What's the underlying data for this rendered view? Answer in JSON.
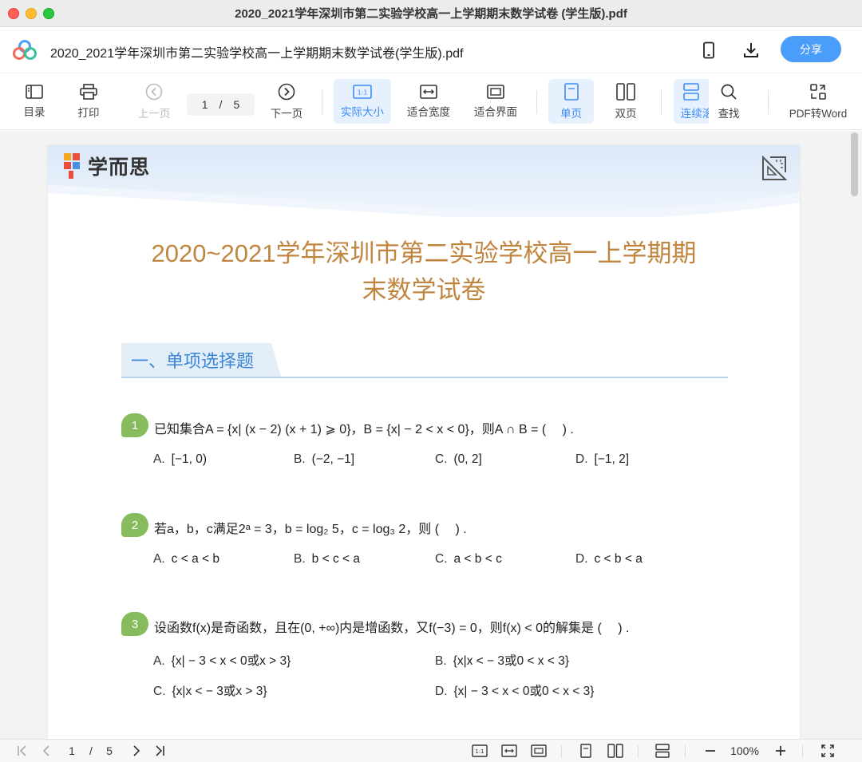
{
  "window": {
    "title": "2020_2021学年深圳市第二实验学校高一上学期期末数学试卷 (学生版).pdf"
  },
  "header": {
    "doc_title": "2020_2021学年深圳市第二实验学校高一上学期期末数学试卷(学生版).pdf",
    "share_label": "分享",
    "icons": [
      "phone-icon",
      "download-icon"
    ]
  },
  "toolbar": {
    "toc": "目录",
    "print": "打印",
    "prev": "上一页",
    "page_current": "1",
    "page_sep": "/",
    "page_total": "5",
    "next": "下一页",
    "actual_size": "实际大小",
    "actual_size_glyph": "1:1",
    "fit_width": "适合宽度",
    "fit_page": "适合界面",
    "single": "单页",
    "double": "双页",
    "continuous": "连续滚",
    "find": "查找",
    "to_word": "PDF转Word"
  },
  "document": {
    "brand": "学而思",
    "title_line1": "2020~2021学年深圳市第二实验学校高一上学期期",
    "title_line2": "末数学试卷",
    "section": "一、单项选择题",
    "questions": [
      {
        "num": "1",
        "text": "已知集合A = {x| (x − 2) (x + 1) ⩾ 0}，B = {x| − 2 < x < 0}，则A ∩ B = (　 ) .",
        "options": [
          {
            "label": "A.",
            "text": "[−1, 0)"
          },
          {
            "label": "B.",
            "text": "(−2, −1]"
          },
          {
            "label": "C.",
            "text": "(0, 2]"
          },
          {
            "label": "D.",
            "text": "[−1, 2]"
          }
        ]
      },
      {
        "num": "2",
        "text": "若a，b，c满足2ᵃ = 3，b = log₂ 5，c = log₃ 2，则 (　 ) .",
        "options": [
          {
            "label": "A.",
            "text": "c < a < b"
          },
          {
            "label": "B.",
            "text": "b < c < a"
          },
          {
            "label": "C.",
            "text": "a < b < c"
          },
          {
            "label": "D.",
            "text": "c < b < a"
          }
        ]
      },
      {
        "num": "3",
        "text": "设函数f(x)是奇函数，且在(0, +∞)内是增函数，又f(−3) = 0，则f(x) < 0的解集是 (　 ) .",
        "options": [
          {
            "label": "A.",
            "text": "{x| − 3 < x < 0或x > 3}"
          },
          {
            "label": "B.",
            "text": "{x|x < − 3或0 < x < 3}"
          },
          {
            "label": "C.",
            "text": "{x|x < − 3或x > 3}"
          },
          {
            "label": "D.",
            "text": "{x| − 3 < x < 0或0 < x < 3}"
          }
        ]
      }
    ]
  },
  "statusbar": {
    "page_current": "1",
    "page_sep": "/",
    "page_total": "5",
    "zoom": "100%",
    "actual_glyph": "1:1"
  },
  "colors": {
    "accent": "#4a9df8",
    "title_gold": "#c0863f",
    "section_blue": "#3b86d6",
    "badge_green": "#86bc5d"
  }
}
